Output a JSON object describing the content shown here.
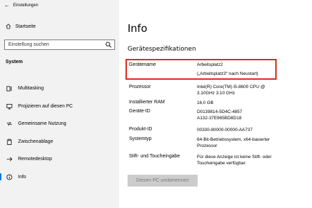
{
  "window": {
    "title": "Einstellungen"
  },
  "sidebar": {
    "home_label": "Startseite",
    "search_placeholder": "Einstellung suchen",
    "section_label": "System",
    "items": [
      {
        "label": "Multitasking",
        "icon": "multitasking-icon"
      },
      {
        "label": "Projizieren auf diesen PC",
        "icon": "project-icon"
      },
      {
        "label": "Gemeinsame Nutzung",
        "icon": "shared-experiences-icon"
      },
      {
        "label": "Zwischenablage",
        "icon": "clipboard-icon"
      },
      {
        "label": "Remotedesktop",
        "icon": "remote-desktop-icon"
      },
      {
        "label": "Info",
        "icon": "info-icon",
        "active": true
      }
    ],
    "accent_color": "#0078d7"
  },
  "main": {
    "title": "Info",
    "section_title": "Gerätespezifikationen",
    "specs": [
      {
        "label": "Gerätename",
        "value_lines": [
          "Arbeitsplatz2",
          "(„Arbeitsplatz3“ nach Neustart)"
        ]
      },
      {
        "label": "Prozessor",
        "value_lines": [
          "Intel(R) Core(TM) i5-8600 CPU @",
          "3.10GHz   3.10 GHz"
        ]
      },
      {
        "label": "Installierter RAM",
        "value_lines": [
          "16,0 GB"
        ]
      },
      {
        "label": "Geräte-ID",
        "value_lines": [
          "D0139814-5D4C-4857",
          "A132-37E965BD8D18"
        ]
      },
      {
        "label": "Produkt-ID",
        "value_lines": [
          "00330-80000-00000-AA737"
        ]
      },
      {
        "label": "Systemtyp",
        "value_lines": [
          "64-Bit-Betriebssystem, x64-basierter",
          "Prozessor"
        ]
      },
      {
        "label": "Stift- und Toucheingabe",
        "value_lines": [
          "Für diese Anzeige ist keine Stift- oder",
          "Toucheingabe verfügbar."
        ]
      }
    ],
    "rename_button": "Diesen PC umbenennen",
    "highlight_color": "#e0251b"
  }
}
